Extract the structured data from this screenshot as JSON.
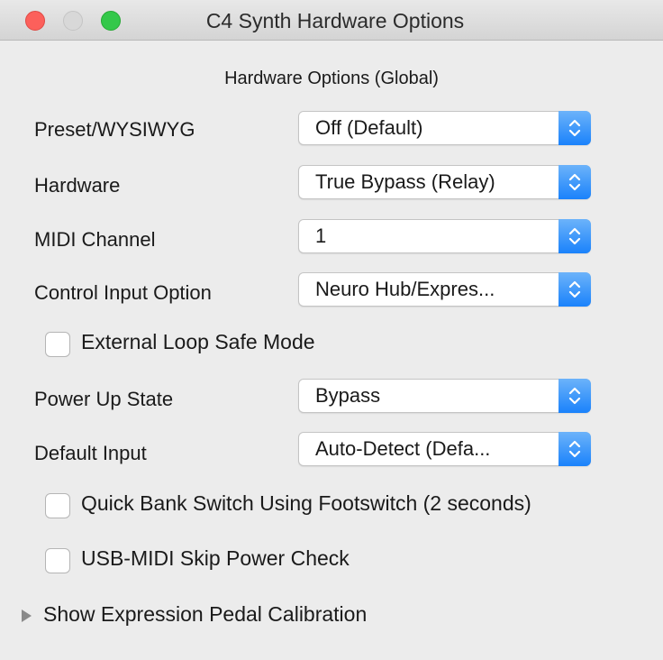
{
  "window": {
    "title": "C4 Synth Hardware Options",
    "traffic_colors": {
      "close": "#fc605b",
      "minimize": "#d8d8d8",
      "zoom": "#34c84a"
    }
  },
  "heading": "Hardware Options (Global)",
  "rows": {
    "preset": {
      "label": "Preset/WYSIWYG",
      "value": "Off (Default)"
    },
    "hardware": {
      "label": "Hardware",
      "value": "True Bypass (Relay)"
    },
    "midi": {
      "label": "MIDI Channel",
      "value": "1"
    },
    "control": {
      "label": "Control Input Option",
      "value": "Neuro Hub/Expres..."
    },
    "power": {
      "label": "Power Up State",
      "value": "Bypass"
    },
    "input": {
      "label": "Default Input",
      "value": "Auto-Detect (Defa..."
    }
  },
  "checkboxes": {
    "external_loop": {
      "label": "External Loop Safe Mode",
      "checked": false
    },
    "quick_bank": {
      "label": "Quick Bank Switch Using Footswitch (2 seconds)",
      "checked": false
    },
    "usb_midi": {
      "label": "USB-MIDI Skip Power Check",
      "checked": false
    }
  },
  "disclosure": {
    "label": "Show Expression Pedal Calibration",
    "expanded": false
  },
  "accent_color": "#1a82fb",
  "icons": {
    "popup": "up-down-chevron-icon",
    "disclosure": "disclosure-triangle-icon"
  }
}
